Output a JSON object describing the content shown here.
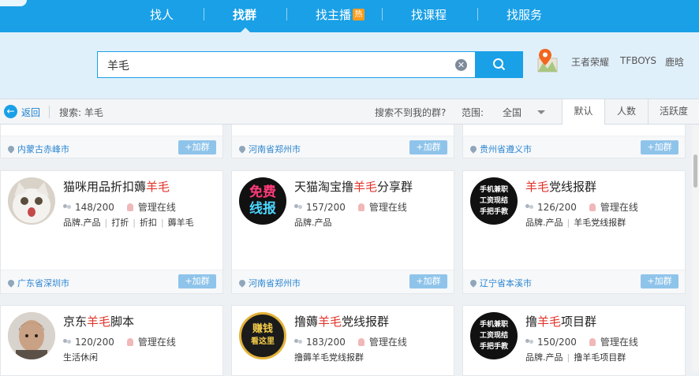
{
  "nav": {
    "items": [
      "找人",
      "找群",
      "找主播",
      "找课程",
      "找服务"
    ],
    "active": "找群",
    "hot_badge": "热"
  },
  "search": {
    "query": "羊毛",
    "clear_icon": "clear-icon",
    "button_icon": "search-icon"
  },
  "hot_words": [
    "王者荣耀",
    "TFBOYS",
    "鹿晗"
  ],
  "filter": {
    "back_label": "返回",
    "search_prefix": "搜索: ",
    "search_term": "羊毛",
    "not_found": "搜索不到我的群?",
    "range_label": "范围:",
    "range_value": "全国",
    "sort_tabs": [
      "默认",
      "人数",
      "活跃度"
    ],
    "active_sort": "默认"
  },
  "add_label": "+加群",
  "top_row_locations": [
    "内蒙古赤峰市",
    "河南省郑州市",
    "贵州省遵义市"
  ],
  "groups": [
    {
      "name_pre": "猫咪用品折扣薅",
      "name_hl": "羊毛",
      "name_post": "",
      "members": "148/200",
      "status": "管理在线",
      "tags": [
        "品牌.产品",
        "打折",
        "折扣",
        "薅羊毛"
      ],
      "location": "广东省深圳市",
      "avatar": "cat"
    },
    {
      "name_pre": "天猫淘宝撸",
      "name_hl": "羊毛",
      "name_post": "分享群",
      "members": "157/200",
      "status": "管理在线",
      "tags": [
        "品牌.产品"
      ],
      "location": "河南省郑州市",
      "avatar_text": [
        "免费",
        "线报"
      ]
    },
    {
      "name_pre": "",
      "name_hl": "羊毛",
      "name_post": "党线报群",
      "members": "126/200",
      "status": "管理在线",
      "tags": [
        "品牌.产品",
        "羊毛党线报群"
      ],
      "location": "辽宁省本溪市",
      "avatar_text": [
        "手机兼职",
        "工资现结",
        "手把手教"
      ]
    },
    {
      "name_pre": "京东",
      "name_hl": "羊毛",
      "name_post": "脚本",
      "members": "120/200",
      "status": "管理在线",
      "tags": [
        "生活休闲"
      ],
      "location": "",
      "avatar": "man"
    },
    {
      "name_pre": "撸薅",
      "name_hl": "羊毛",
      "name_post": "党线报群",
      "members": "183/200",
      "status": "管理在线",
      "tags": [
        "撸薅羊毛党线报群"
      ],
      "location": "",
      "avatar_text": [
        "赚钱",
        "看这里"
      ]
    },
    {
      "name_pre": "撸",
      "name_hl": "羊毛",
      "name_post": "项目群",
      "members": "150/200",
      "status": "管理在线",
      "tags": [
        "品牌.产品",
        "撸羊毛项目群"
      ],
      "location": "",
      "avatar_text": [
        "手机兼职",
        "工资现结",
        "手把手教"
      ]
    }
  ]
}
